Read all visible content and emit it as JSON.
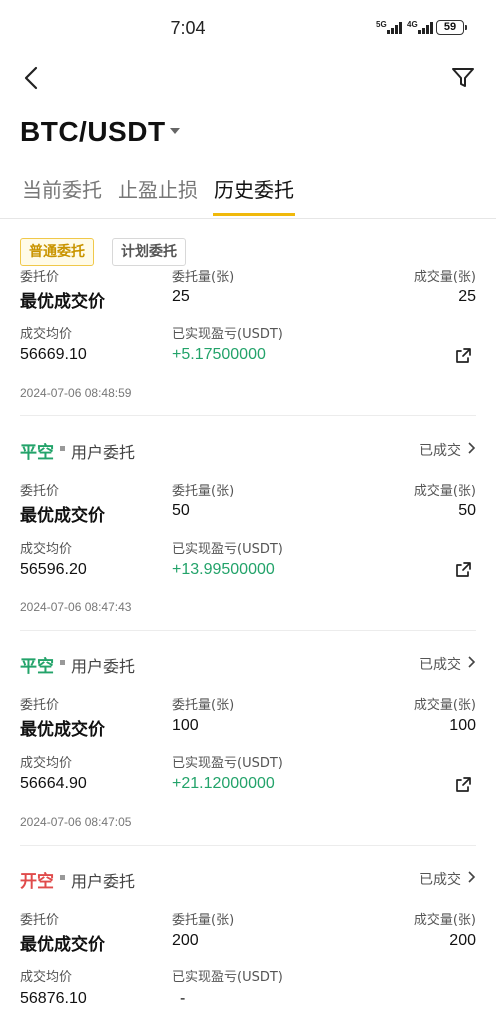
{
  "status_bar": {
    "time": "7:04",
    "signal1": "5G",
    "signal2": "4G",
    "battery": "59"
  },
  "header": {
    "pair": "BTC/USDT"
  },
  "tabs": [
    "当前委托",
    "止盈止损",
    "历史委托"
  ],
  "chips": [
    "普通委托",
    "计划委托"
  ],
  "labels": {
    "order_price": "委托价",
    "order_qty": "委托量(张)",
    "filled_qty": "成交量(张)",
    "avg_price": "成交均价",
    "realized_pnl": "已实现盈亏(USDT)"
  },
  "orders": [
    {
      "price": "最优成交价",
      "qty": "25",
      "filled": "25",
      "avg": "56669.10",
      "pnl": "+5.17500000",
      "time": "2024-07-06 08:48:59"
    },
    {
      "side": "平空",
      "source": "用户委托",
      "status": "已成交",
      "price": "最优成交价",
      "qty": "50",
      "filled": "50",
      "avg": "56596.20",
      "pnl": "+13.99500000",
      "time": "2024-07-06 08:47:43"
    },
    {
      "side": "平空",
      "source": "用户委托",
      "status": "已成交",
      "price": "最优成交价",
      "qty": "100",
      "filled": "100",
      "avg": "56664.90",
      "pnl": "+21.12000000",
      "time": "2024-07-06 08:47:05"
    },
    {
      "side": "开空",
      "source": "用户委托",
      "status": "已成交",
      "price": "最优成交价",
      "qty": "200",
      "filled": "200",
      "avg": "56876.10",
      "pnl": "-"
    }
  ],
  "colors": {
    "accent": "#f0b90b",
    "profit": "#23a36a",
    "open_short": "#e04b4b"
  }
}
